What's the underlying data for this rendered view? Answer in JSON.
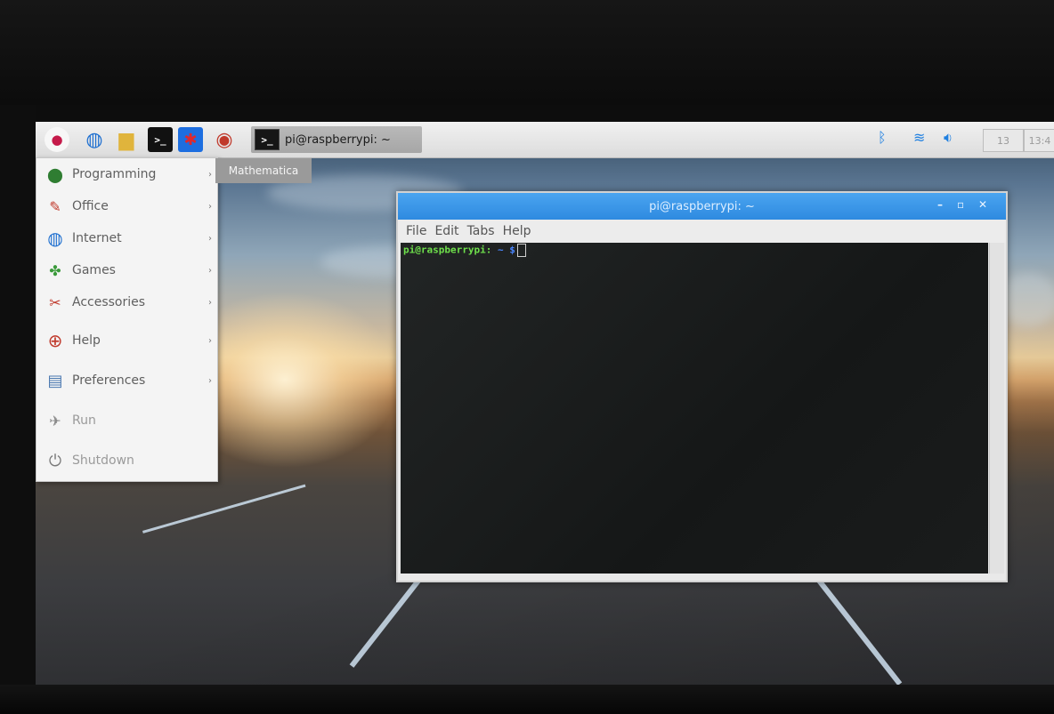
{
  "taskbar": {
    "launchers": [
      {
        "icon": "raspberry-icon",
        "color": "#c51a4a"
      },
      {
        "icon": "globe-icon",
        "color": "#1e6fd0"
      },
      {
        "icon": "folder-icon",
        "color": "#e0b43c"
      },
      {
        "icon": "terminal-icon",
        "color": "#111111"
      },
      {
        "icon": "mathematica-icon",
        "color": "#d4282c"
      },
      {
        "icon": "wolfram-icon",
        "color": "#c0392b"
      }
    ],
    "task_button": {
      "label": "pi@raspberrypi: ~"
    },
    "tray": {
      "bluetooth_icon": "bluetooth-icon",
      "wifi_icon": "wifi-icon",
      "volume_icon": "volume-icon",
      "cpu": "13",
      "clock": "13:4"
    }
  },
  "tooltip": {
    "text": "Mathematica"
  },
  "menu": {
    "items": [
      {
        "label": "Programming",
        "icon": "programming-icon",
        "submenu": "›"
      },
      {
        "label": "Office",
        "icon": "office-icon",
        "submenu": "›"
      },
      {
        "label": "Internet",
        "icon": "internet-icon",
        "submenu": "›"
      },
      {
        "label": "Games",
        "icon": "games-icon",
        "submenu": "›"
      },
      {
        "label": "Accessories",
        "icon": "accessories-icon",
        "submenu": "›"
      },
      {
        "label": "Help",
        "icon": "help-icon",
        "submenu": "›"
      },
      {
        "label": "Preferences",
        "icon": "preferences-icon",
        "submenu": "›"
      },
      {
        "label": "Run",
        "icon": "run-icon",
        "submenu": ""
      },
      {
        "label": "Shutdown",
        "icon": "shutdown-icon",
        "submenu": ""
      }
    ]
  },
  "terminal": {
    "title": "pi@raspberrypi: ~",
    "controls": {
      "minimize": "–",
      "maximize": "▫",
      "close": "✕"
    },
    "menubar": [
      "File",
      "Edit",
      "Tabs",
      "Help"
    ],
    "prompt_user": "pi@raspberrypi:",
    "prompt_path": " ~ $"
  }
}
